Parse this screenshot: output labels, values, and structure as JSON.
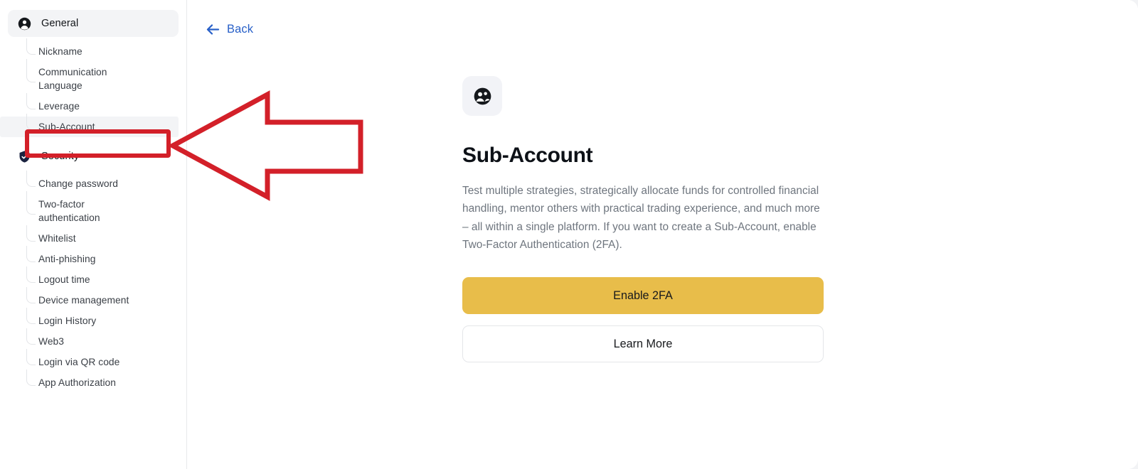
{
  "sidebar": {
    "sections": [
      {
        "id": "general",
        "label": "General",
        "icon": "user-circle-icon",
        "active": true,
        "items": [
          {
            "label": "Nickname",
            "two_line": false,
            "highlighted": false
          },
          {
            "label": "Communication Language",
            "two_line": true,
            "highlighted": false
          },
          {
            "label": "Leverage",
            "two_line": false,
            "highlighted": false
          },
          {
            "label": "Sub-Account",
            "two_line": false,
            "highlighted": true
          }
        ]
      },
      {
        "id": "security",
        "label": "Security",
        "icon": "shield-check-icon",
        "active": false,
        "items": [
          {
            "label": "Change password",
            "two_line": false,
            "highlighted": false
          },
          {
            "label": "Two-factor authentication",
            "two_line": true,
            "highlighted": false
          },
          {
            "label": "Whitelist",
            "two_line": false,
            "highlighted": false
          },
          {
            "label": "Anti-phishing",
            "two_line": false,
            "highlighted": false
          },
          {
            "label": "Logout time",
            "two_line": false,
            "highlighted": false
          },
          {
            "label": "Device management",
            "two_line": false,
            "highlighted": false
          },
          {
            "label": "Login History",
            "two_line": false,
            "highlighted": false
          },
          {
            "label": "Web3",
            "two_line": false,
            "highlighted": false
          },
          {
            "label": "Login via QR code",
            "two_line": false,
            "highlighted": false
          },
          {
            "label": "App Authorization",
            "two_line": false,
            "highlighted": false
          }
        ]
      }
    ]
  },
  "main": {
    "back_label": "Back",
    "badge_icon": "sub-account-users-icon",
    "title": "Sub-Account",
    "description": "Test multiple strategies, strategically allocate funds for controlled financial handling, mentor others with practical trading experience, and much more – all within a single platform. If you want to create a Sub-Account, enable Two-Factor Authentication (2FA).",
    "primary_button": "Enable 2FA",
    "secondary_button": "Learn More"
  },
  "annotation": {
    "type": "red-arrow-pointing-left",
    "target": "Sub-Account",
    "color": "#d32029",
    "highlight_box_color": "#d32029"
  },
  "colors": {
    "accent_primary": "#e8bd4a",
    "link_blue": "#2860c8",
    "annotation_red": "#d32029",
    "text_primary": "#0d1117",
    "text_muted": "#6e757e",
    "sidebar_active_bg": "#f3f4f6",
    "badge_bg": "#f2f3f7",
    "page_bg": "#f2f3f5"
  }
}
